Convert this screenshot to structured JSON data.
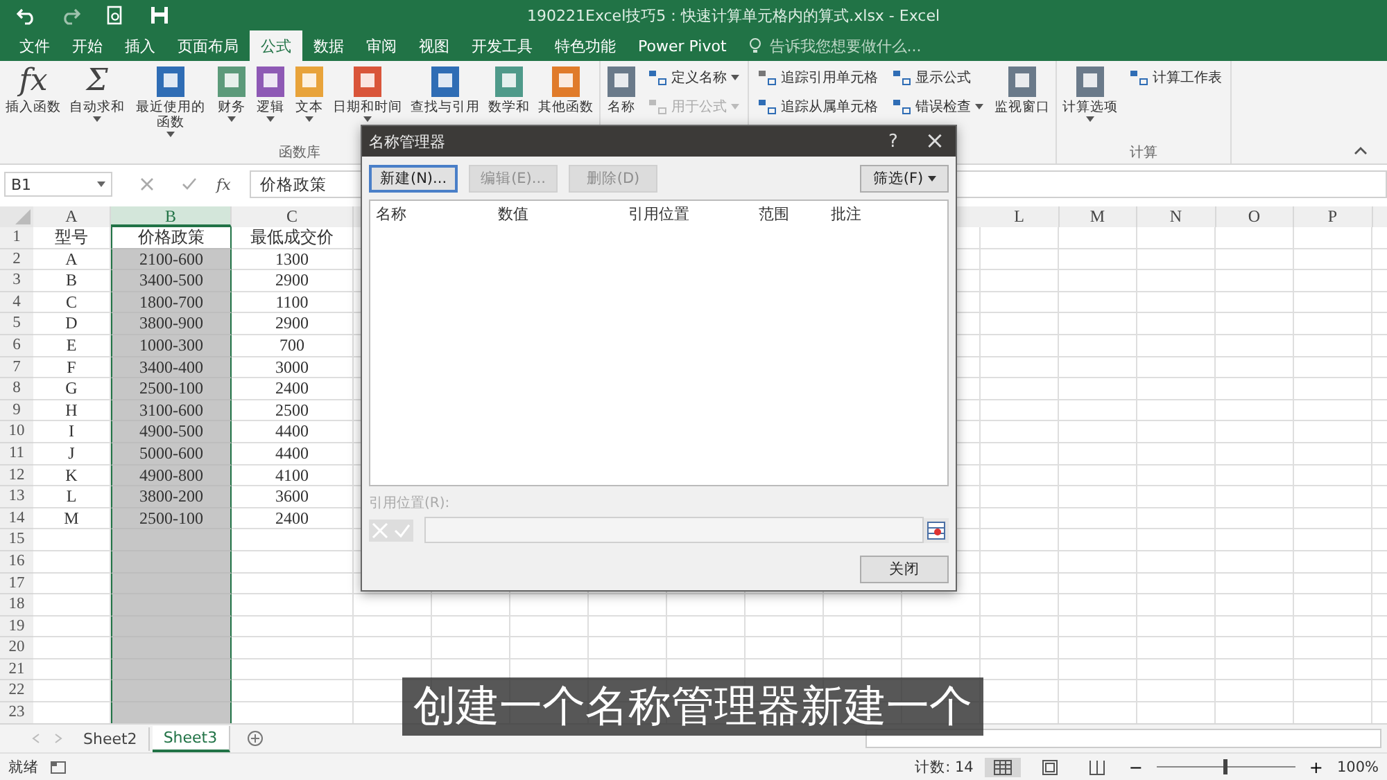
{
  "window": {
    "title": "190221Excel技巧5：快速计算单元格内的算式.xlsx - Excel"
  },
  "tabs": [
    {
      "label": "文件",
      "selected": false
    },
    {
      "label": "开始",
      "selected": false
    },
    {
      "label": "插入",
      "selected": false
    },
    {
      "label": "页面布局",
      "selected": false
    },
    {
      "label": "公式",
      "selected": true
    },
    {
      "label": "数据",
      "selected": false
    },
    {
      "label": "审阅",
      "selected": false
    },
    {
      "label": "视图",
      "selected": false
    },
    {
      "label": "开发工具",
      "selected": false
    },
    {
      "label": "特色功能",
      "selected": false
    },
    {
      "label": "Power Pivot",
      "selected": false
    }
  ],
  "tell_me": {
    "placeholder": "告诉我您想要做什么..."
  },
  "ribbon": {
    "groups": [
      {
        "label": "函数库",
        "items": [
          {
            "kind": "large",
            "label": "插入函数",
            "glyph": "fx",
            "dropdown": false
          },
          {
            "kind": "large",
            "label": "自动求和",
            "glyph": "Σ",
            "dropdown": true
          },
          {
            "kind": "large",
            "label": "最近使用的函数",
            "dropdown": true
          },
          {
            "kind": "large",
            "label": "财务",
            "dropdown": true
          },
          {
            "kind": "large",
            "label": "逻辑",
            "dropdown": true
          },
          {
            "kind": "large",
            "label": "文本",
            "dropdown": true
          },
          {
            "kind": "large",
            "label": "日期和时间",
            "dropdown": true
          },
          {
            "kind": "large",
            "label": "查找与引用",
            "dropdown": false
          },
          {
            "kind": "large",
            "label": "数学和",
            "dropdown": false
          },
          {
            "kind": "large",
            "label": "其他函数",
            "dropdown": false
          }
        ]
      },
      {
        "items": [
          {
            "kind": "large",
            "label": "名称",
            "dropdown": false
          },
          {
            "kind": "small",
            "label": "定义名称",
            "dropdown": true,
            "disabled": false
          },
          {
            "kind": "small",
            "label": "用于公式",
            "dropdown": true,
            "disabled": true
          }
        ]
      },
      {
        "items": [
          {
            "kind": "small",
            "label": "追踪引用单元格",
            "dropdown": false,
            "disabled": false
          },
          {
            "kind": "small",
            "label": "追踪从属单元格",
            "dropdown": false,
            "disabled": false
          },
          {
            "kind": "small",
            "label": "显示公式",
            "dropdown": false,
            "disabled": false
          },
          {
            "kind": "small",
            "label": "错误检查",
            "dropdown": true,
            "disabled": false
          },
          {
            "kind": "large",
            "label": "监视窗口",
            "dropdown": false
          }
        ]
      },
      {
        "label": "计算",
        "items": [
          {
            "kind": "large",
            "label": "计算选项",
            "dropdown": true
          },
          {
            "kind": "small",
            "label": "计算工作表",
            "dropdown": false,
            "disabled": false
          }
        ]
      }
    ]
  },
  "formula_bar": {
    "name_box": "B1",
    "fx": "fx",
    "value": "价格政策"
  },
  "columns": [
    {
      "label": "A",
      "selected": false
    },
    {
      "label": "B",
      "selected": true
    },
    {
      "label": "C",
      "selected": false
    },
    {
      "label": "L",
      "selected": false
    },
    {
      "label": "M",
      "selected": false
    },
    {
      "label": "N",
      "selected": false
    },
    {
      "label": "O",
      "selected": false
    },
    {
      "label": "P",
      "selected": false
    }
  ],
  "rows": [
    {
      "number": "1",
      "cells": [
        "型号",
        "价格政策",
        "最低成交价"
      ]
    },
    {
      "number": "2",
      "cells": [
        "A",
        "2100-600",
        "1300"
      ]
    },
    {
      "number": "3",
      "cells": [
        "B",
        "3400-500",
        "2900"
      ]
    },
    {
      "number": "4",
      "cells": [
        "C",
        "1800-700",
        "1100"
      ]
    },
    {
      "number": "5",
      "cells": [
        "D",
        "3800-900",
        "2900"
      ]
    },
    {
      "number": "6",
      "cells": [
        "E",
        "1000-300",
        "700"
      ]
    },
    {
      "number": "7",
      "cells": [
        "F",
        "3400-400",
        "3000"
      ]
    },
    {
      "number": "8",
      "cells": [
        "G",
        "2500-100",
        "2400"
      ]
    },
    {
      "number": "9",
      "cells": [
        "H",
        "3100-600",
        "2500"
      ]
    },
    {
      "number": "10",
      "cells": [
        "I",
        "4900-500",
        "4400"
      ]
    },
    {
      "number": "11",
      "cells": [
        "J",
        "5000-600",
        "4400"
      ]
    },
    {
      "number": "12",
      "cells": [
        "K",
        "4900-800",
        "4100"
      ]
    },
    {
      "number": "13",
      "cells": [
        "L",
        "3800-200",
        "3600"
      ]
    },
    {
      "number": "14",
      "cells": [
        "M",
        "2500-100",
        "2400"
      ]
    },
    {
      "number": "15"
    },
    {
      "number": "16"
    },
    {
      "number": "17"
    },
    {
      "number": "18"
    },
    {
      "number": "19"
    },
    {
      "number": "20"
    },
    {
      "number": "21"
    },
    {
      "number": "22"
    },
    {
      "number": "23"
    }
  ],
  "sheet_tabs": [
    {
      "label": "Sheet2",
      "selected": false
    },
    {
      "label": "Sheet3",
      "selected": true
    }
  ],
  "status_bar": {
    "status": "就绪",
    "count": "计数: 14",
    "zoom": {
      "level": 0.5,
      "minus": "−",
      "plus": "+",
      "percent": "100%"
    }
  },
  "dialog": {
    "title": "名称管理器",
    "help": "?",
    "close": "×",
    "buttons": [
      {
        "label": "新建(N)...",
        "disabled": false
      },
      {
        "label": "编辑(E)...",
        "disabled": true
      },
      {
        "label": "删除(D)",
        "disabled": true
      }
    ],
    "filter": "筛选(F)",
    "list_columns": [
      "名称",
      "数值",
      "引用位置",
      "范围",
      "批注"
    ],
    "refers_label": "引用位置(R):",
    "close_button": "关闭"
  },
  "caption": "创建一个名称管理器新建一个"
}
